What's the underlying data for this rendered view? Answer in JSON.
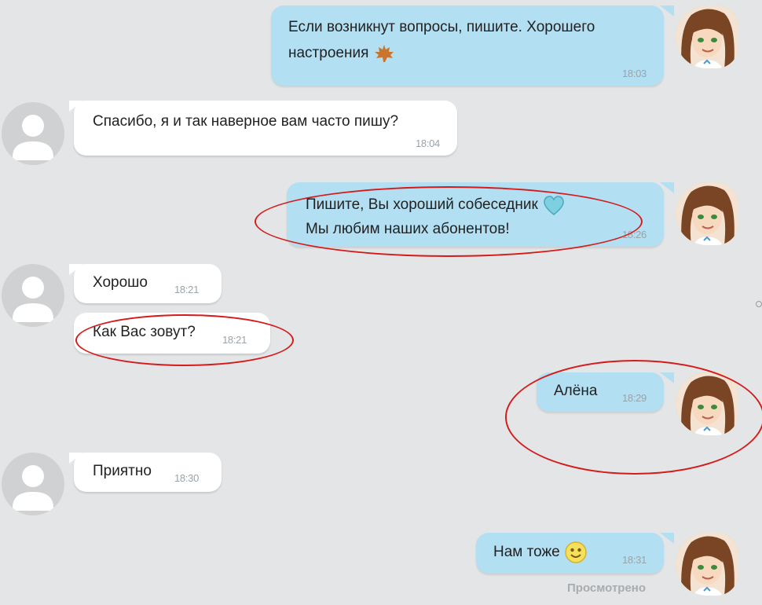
{
  "messages": [
    {
      "text_line1": "Если возникнут вопросы, пишите. Хорошего",
      "text_line2": "настроения",
      "time": "18:03",
      "emoji": "maple-leaf-emoji"
    },
    {
      "text": "Спасибо, я и так наверное вам часто пишу?",
      "time": "18:04"
    },
    {
      "text_line1": "Пишите, Вы хороший собеседник",
      "text_line2": "Мы любим наших абонентов!",
      "time": "18:26",
      "emoji": "heart-emoji"
    },
    {
      "text": "Хорошо",
      "time": "18:21"
    },
    {
      "text": "Как Вас зовут?",
      "time": "18:21"
    },
    {
      "text": "Алёна",
      "time": "18:29"
    },
    {
      "text": "Приятно",
      "time": "18:30"
    },
    {
      "text": "Нам тоже",
      "time": "18:31",
      "emoji": "smiley-emoji"
    }
  ],
  "status": {
    "seen": "Просмотрено"
  },
  "colors": {
    "outgoing_bubble": "#b3dff2",
    "incoming_bubble": "#ffffff",
    "highlight_ring": "#d41c1c",
    "background": "#e4e5e6"
  }
}
